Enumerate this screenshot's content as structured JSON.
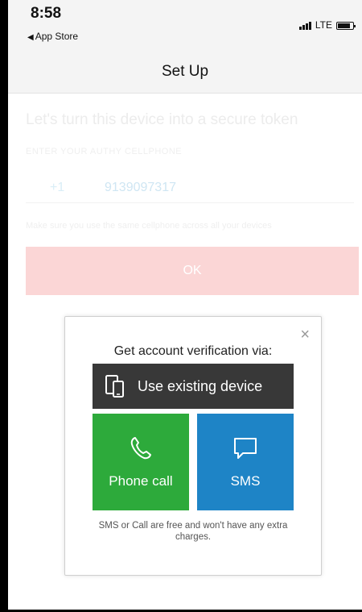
{
  "status_bar": {
    "time": "8:58",
    "back_label": "App Store",
    "network": "LTE"
  },
  "nav": {
    "title": "Set Up"
  },
  "background_form": {
    "headline": "Let's turn this device into a secure token",
    "enter_label": "ENTER YOUR AUTHY CELLPHONE",
    "country_code": "+1",
    "phone_number": "9139097317",
    "hint": "Make sure you use the same cellphone across all your devices",
    "ok_label": "OK"
  },
  "dialog": {
    "title": "Get account verification via:",
    "existing_device_label": "Use existing device",
    "phone_call_label": "Phone call",
    "sms_label": "SMS",
    "note": "SMS or Call are free and won't have any extra charges.",
    "close_symbol": "×"
  },
  "colors": {
    "phone_call_tile": "#2daa3b",
    "sms_tile": "#1e84c6",
    "existing_device_button": "#383838",
    "ok_button": "#fbd6d6"
  },
  "icons": {
    "existing_device": "devices-icon",
    "phone_call": "phone-icon",
    "sms": "chat-bubble-icon"
  }
}
